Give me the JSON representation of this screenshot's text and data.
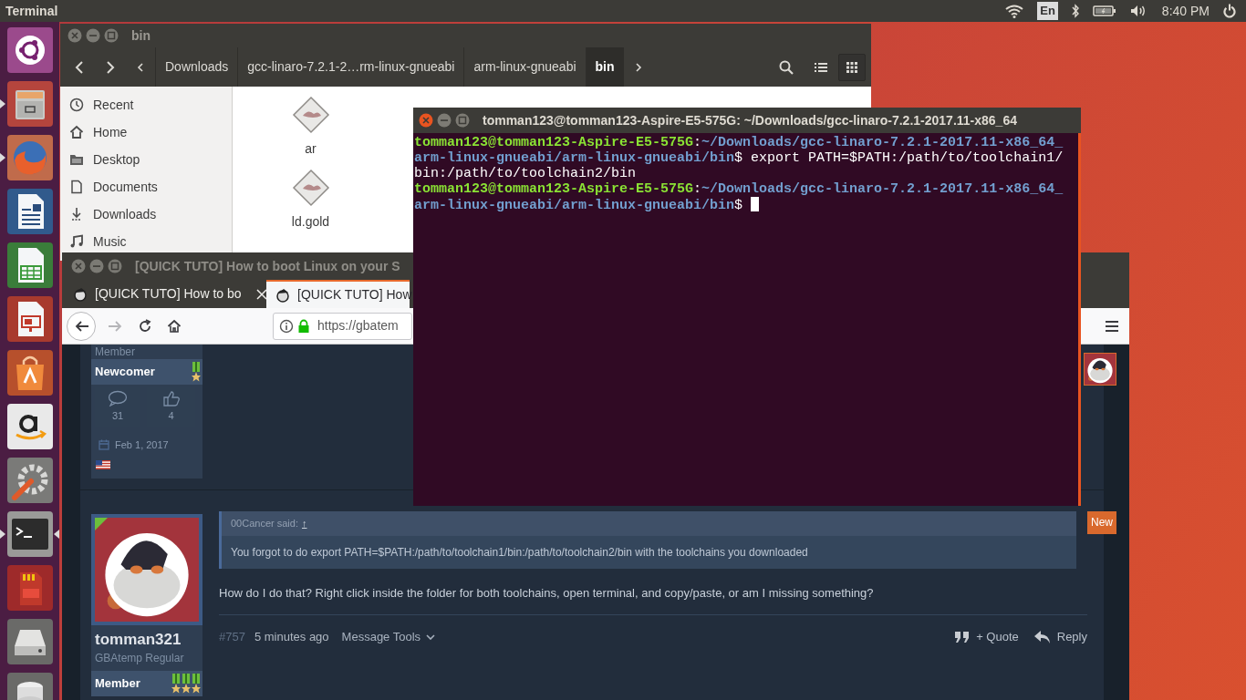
{
  "top_panel": {
    "app_name": "Terminal",
    "keyboard_layout": "En",
    "time": "8:40 PM"
  },
  "launcher": {
    "items": [
      {
        "kind": "dash",
        "running": false,
        "focused": false
      },
      {
        "kind": "files",
        "running": true,
        "focused": false
      },
      {
        "kind": "browser",
        "running": true,
        "focused": false
      },
      {
        "kind": "writer",
        "running": false,
        "focused": false
      },
      {
        "kind": "calc",
        "running": false,
        "focused": false
      },
      {
        "kind": "impress",
        "running": false,
        "focused": false
      },
      {
        "kind": "software",
        "running": false,
        "focused": false
      },
      {
        "kind": "shop",
        "running": false,
        "focused": false
      },
      {
        "kind": "settings",
        "running": false,
        "focused": false
      },
      {
        "kind": "terminal",
        "running": true,
        "focused": true
      },
      {
        "kind": "sdcard",
        "running": false,
        "focused": false
      },
      {
        "kind": "drive",
        "running": false,
        "focused": false
      },
      {
        "kind": "disk",
        "running": false,
        "focused": false
      }
    ]
  },
  "file_manager": {
    "title": "bin",
    "path": [
      {
        "label": "Downloads",
        "selected": false
      },
      {
        "label": "gcc-linaro-7.2.1-2…rm-linux-gnueabi",
        "selected": false
      },
      {
        "label": "arm-linux-gnueabi",
        "selected": false
      },
      {
        "label": "bin",
        "selected": true
      }
    ],
    "places": [
      {
        "kind": "recent",
        "label": "Recent"
      },
      {
        "kind": "home",
        "label": "Home"
      },
      {
        "kind": "desktop",
        "label": "Desktop"
      },
      {
        "kind": "documents",
        "label": "Documents"
      },
      {
        "kind": "downloads",
        "label": "Downloads"
      },
      {
        "kind": "music",
        "label": "Music"
      }
    ],
    "files": [
      {
        "kind": "executable",
        "name": "ar"
      },
      {
        "kind": "executable",
        "name": "ld.gold"
      }
    ]
  },
  "terminal": {
    "title": "tomman123@tomman123-Aspire-E5-575G: ~/Downloads/gcc-linaro-7.2.1-2017.11-x86_64",
    "lines": [
      {
        "user": "tomman123@tomman123-Aspire-E5-575G",
        "separator": ":",
        "path": "~/Downloads/gcc-linaro-7.2.1-2017.11-x86_64_arm-linux-gnueabi/arm-linux-gnueabi/bin",
        "prompt": "$ ",
        "command": "export PATH=$PATH:/path/to/toolchain1/bin:/path/to/toolchain2/bin",
        "cursor": false
      },
      {
        "user": "tomman123@tomman123-Aspire-E5-575G",
        "separator": ":",
        "path": "~/Downloads/gcc-linaro-7.2.1-2017.11-x86_64_arm-linux-gnueabi/arm-linux-gnueabi/bin",
        "prompt": "$ ",
        "cursor": true
      }
    ]
  },
  "browser": {
    "title": "[QUICK TUTO] How to boot Linux on your S",
    "tabs": [
      {
        "label": "[QUICK TUTO] How to bo",
        "selected": false
      },
      {
        "label": "[QUICK TUTO] How",
        "selected": true
      }
    ],
    "nav": [
      {
        "kind": "back",
        "disabled": false
      },
      {
        "kind": "forward",
        "disabled": true
      },
      {
        "kind": "reload",
        "disabled": false
      },
      {
        "kind": "home",
        "disabled": false
      }
    ],
    "url": "https://gbatem",
    "posts": [
      {
        "user_title": "Member",
        "rank": "Newcomer",
        "medals": [
          {
            "kind": "medal"
          }
        ],
        "messages": "31",
        "likes": "4",
        "joined": "Feb 1, 2017",
        "side_avatar": {
          "kind": "picture"
        }
      },
      {
        "avatar": {
          "kind": "picture"
        },
        "username": "tomman321",
        "user_title": "GBAtemp Regular",
        "rank": "Member",
        "medals": [
          {
            "kind": "medal"
          },
          {
            "kind": "medal"
          },
          {
            "kind": "medal"
          }
        ],
        "new_badge": "New",
        "quote": {
          "author": "00Cancer said:",
          "link": "↑",
          "text": "You forgot to do export PATH=$PATH:/path/to/toolchain1/bin:/path/to/toolchain2/bin with the toolchains you downloaded"
        },
        "body": "How do I do that? Right click inside the folder for both toolchains, open terminal, and copy/paste, or am I missing something?",
        "number": "#757",
        "time": "5 minutes ago",
        "tools": "Message Tools",
        "actions": [
          {
            "kind": "quote",
            "label": "+ Quote"
          },
          {
            "kind": "reply",
            "label": "Reply"
          }
        ]
      }
    ]
  }
}
